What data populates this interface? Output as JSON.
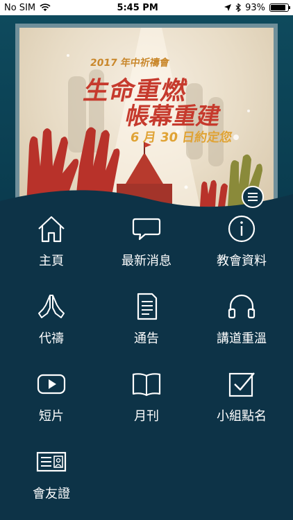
{
  "status_bar": {
    "carrier": "No SIM",
    "time": "5:45 PM",
    "battery": "93%"
  },
  "banner": {
    "tagline": "2017 年中祈禱會",
    "headline_1": "生命重燃",
    "headline_2": "帳幕重建",
    "date_line": "6 月 30 日約定您"
  },
  "menu": {
    "items": [
      {
        "label": "主頁",
        "icon": "home-icon"
      },
      {
        "label": "最新消息",
        "icon": "speech-bubble-icon"
      },
      {
        "label": "教會資料",
        "icon": "info-icon"
      },
      {
        "label": "代禱",
        "icon": "praying-hands-icon"
      },
      {
        "label": "通告",
        "icon": "document-icon"
      },
      {
        "label": "講道重溫",
        "icon": "headphones-icon"
      },
      {
        "label": "短片",
        "icon": "play-video-icon"
      },
      {
        "label": "月刊",
        "icon": "open-book-icon"
      },
      {
        "label": "小組點名",
        "icon": "checkbox-icon"
      },
      {
        "label": "會友證",
        "icon": "member-card-icon"
      }
    ]
  }
}
